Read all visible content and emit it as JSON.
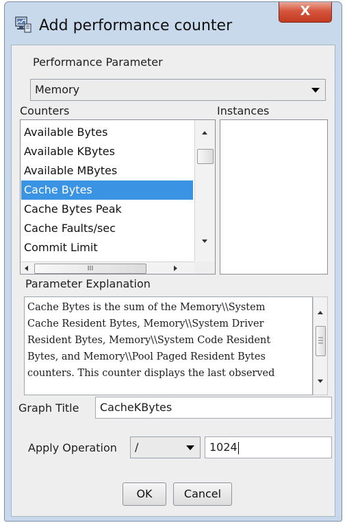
{
  "window": {
    "title": "Add performance counter",
    "close_label": "X"
  },
  "performance_parameter": {
    "label": "Performance Parameter",
    "selected": "Memory"
  },
  "counters": {
    "label": "Counters",
    "items": [
      "Available Bytes",
      "Available KBytes",
      "Available MBytes",
      "Cache Bytes",
      "Cache Bytes Peak",
      "Cache Faults/sec",
      "Commit Limit"
    ],
    "selected": "Cache Bytes",
    "hscroll_thumb_glyph": "III"
  },
  "instances": {
    "label": "Instances"
  },
  "parameter_explanation": {
    "label": "Parameter Explanation",
    "lines": [
      "Cache Bytes is the sum of the Memory\\\\System",
      "Cache Resident Bytes, Memory\\\\System Driver",
      "Resident Bytes, Memory\\\\System Code Resident",
      "Bytes, and Memory\\\\Pool Paged Resident Bytes",
      "counters.  This counter displays the last observed"
    ]
  },
  "graph_title": {
    "label": "Graph Title",
    "value": "CacheKBytes"
  },
  "apply_operation": {
    "label": "Apply Operation",
    "operator": "/",
    "operand": "1024"
  },
  "buttons": {
    "ok": "OK",
    "cancel": "Cancel"
  },
  "colors": {
    "selection": "#3a93e3",
    "close_button": "#c9432b",
    "window_frame": "#c9d9ec",
    "dialog_bg": "#eeeeee"
  },
  "icons": {
    "window": "performance-monitor-icon",
    "close": "close-icon"
  }
}
